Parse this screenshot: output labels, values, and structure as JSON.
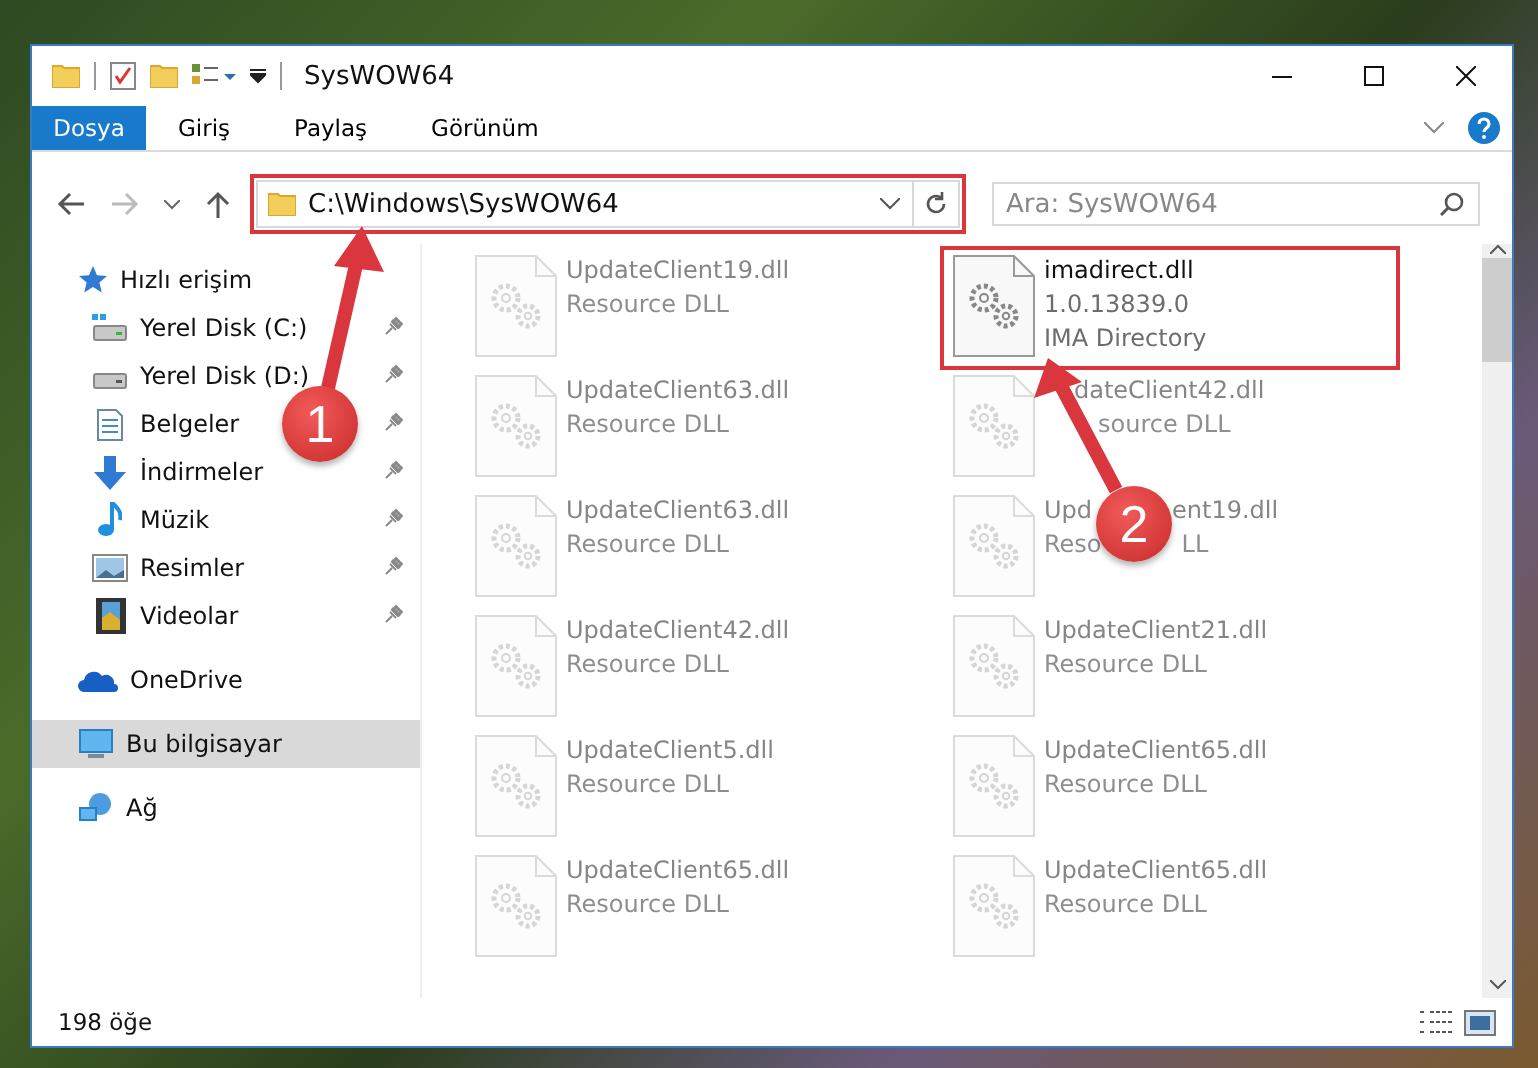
{
  "window": {
    "title": "SysWOW64"
  },
  "ribbon_tabs": [
    {
      "label": "Dosya",
      "kind": "file"
    },
    {
      "label": "Giriş",
      "kind": "tab"
    },
    {
      "label": "Paylaş",
      "kind": "tab"
    },
    {
      "label": "Görünüm",
      "kind": "tab"
    }
  ],
  "address_bar": {
    "path": "C:\\Windows\\SysWOW64",
    "highlighted": true
  },
  "search": {
    "placeholder": "Ara: SysWOW64"
  },
  "sidebar": {
    "items": [
      {
        "label": "Hızlı erişim",
        "selected": false,
        "children": [
          {
            "label": "Yerel Disk (C:)",
            "pinned": true
          },
          {
            "label": "Yerel Disk (D:)",
            "pinned": true
          },
          {
            "label": "Belgeler",
            "pinned": true
          },
          {
            "label": "İndirmeler",
            "pinned": true
          },
          {
            "label": "Müzik",
            "pinned": true
          },
          {
            "label": "Resimler",
            "pinned": true
          },
          {
            "label": "Videolar",
            "pinned": true
          }
        ]
      },
      {
        "label": "OneDrive",
        "selected": false
      },
      {
        "label": "Bu bilgisayar",
        "selected": true
      },
      {
        "label": "Ağ",
        "selected": false
      }
    ]
  },
  "files": [
    {
      "name": "UpdateClient19.dll",
      "details": [
        "Resource DLL"
      ],
      "faded": true,
      "highlighted": false
    },
    {
      "name": "imadirect.dll",
      "details": [
        "1.0.13839.0",
        "IMA Directory"
      ],
      "faded": false,
      "highlighted": true
    },
    {
      "name": "UpdateClient63.dll",
      "details": [
        "Resource DLL"
      ],
      "faded": true,
      "highlighted": false
    },
    {
      "name": "dateClient42.dll",
      "details": [
        "source DLL"
      ],
      "faded": true,
      "highlighted": false,
      "covered_left": true
    },
    {
      "name": "UpdateClient63.dll",
      "details": [
        "Resource DLL"
      ],
      "faded": true,
      "highlighted": false
    },
    {
      "name": [
        "Upd",
        "ent19.dll"
      ],
      "details": [
        [
          "Reso",
          "LL"
        ]
      ],
      "faded": true,
      "highlighted": false
    },
    {
      "name": "UpdateClient42.dll",
      "details": [
        "Resource DLL"
      ],
      "faded": true,
      "highlighted": false
    },
    {
      "name": "UpdateClient21.dll",
      "details": [
        "Resource DLL"
      ],
      "faded": true,
      "highlighted": false
    },
    {
      "name": "UpdateClient5.dll",
      "details": [
        "Resource DLL"
      ],
      "faded": true,
      "highlighted": false
    },
    {
      "name": "UpdateClient65.dll",
      "details": [
        "Resource DLL"
      ],
      "faded": true,
      "highlighted": false
    },
    {
      "name": "UpdateClient65.dll",
      "details": [
        "Resource DLL"
      ],
      "faded": true,
      "highlighted": false
    },
    {
      "name": "UpdateClient65.dll",
      "details": [
        "Resource DLL"
      ],
      "faded": true,
      "highlighted": false
    }
  ],
  "status_bar": {
    "item_count": "198 öğe"
  },
  "callouts": [
    {
      "number": "1"
    },
    {
      "number": "2"
    }
  ]
}
